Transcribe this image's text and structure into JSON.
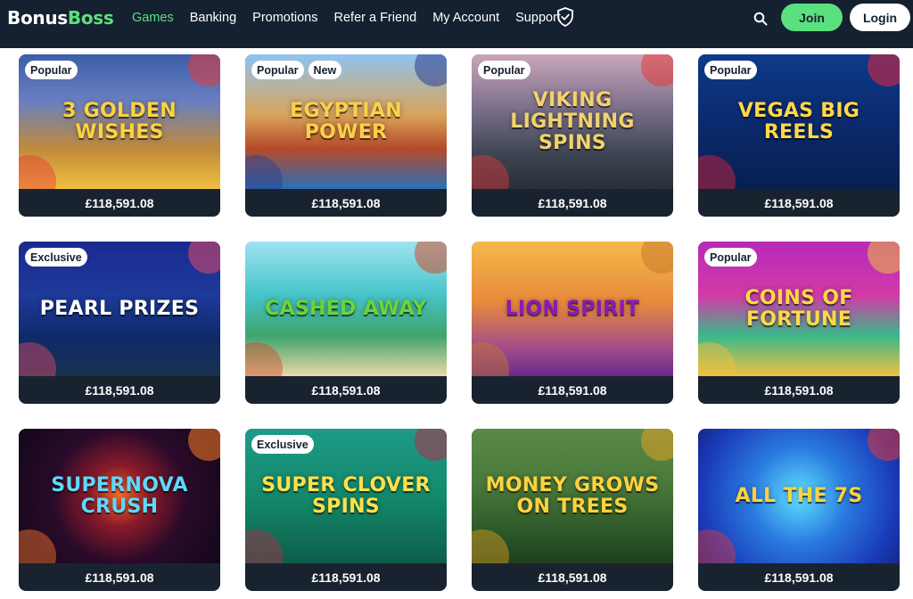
{
  "brand": {
    "part1": "Bonus",
    "part2": "Boss"
  },
  "nav": [
    {
      "label": "Games",
      "active": true
    },
    {
      "label": "Banking",
      "active": false
    },
    {
      "label": "Promotions",
      "active": false
    },
    {
      "label": "Refer a Friend",
      "active": false
    },
    {
      "label": "My Account",
      "active": false
    },
    {
      "label": "Support",
      "active": false
    }
  ],
  "header": {
    "join_label": "Join",
    "login_label": "Login",
    "search_icon": "search-icon",
    "shield_icon": "shield-check-icon"
  },
  "colors": {
    "header_bg": "#152030",
    "accent": "#5be07f",
    "card_footer": "#18232f"
  },
  "games": [
    {
      "title": "3 Golden Wishes",
      "badges": [
        "Popular"
      ],
      "jackpot": "£118,591.08",
      "bg": "linear-gradient(180deg,#3b5fa8 0%,#6a7fc0 35%,#c08a3a 70%,#f0c040 100%)",
      "titleColor": "#ffd23f",
      "deco": "#e83a3a"
    },
    {
      "title": "Egyptian Power",
      "badges": [
        "Popular",
        "New"
      ],
      "jackpot": "£118,591.08",
      "bg": "linear-gradient(180deg,#8fc3f0 0%,#d9a45a 45%,#b64a2a 70%,#2a6fb8 100%)",
      "titleColor": "#ffcf4a",
      "deco": "#2a3e8c"
    },
    {
      "title": "Viking Lightning Spins",
      "badges": [
        "Popular"
      ],
      "jackpot": "£118,591.08",
      "bg": "linear-gradient(180deg,#c9a6b8 0%,#7c6f8c 40%,#3c4452 75%,#2a2f38 100%)",
      "titleColor": "#f2d36b",
      "deco": "#e23b3b"
    },
    {
      "title": "Vegas Big Reels",
      "badges": [
        "Popular"
      ],
      "jackpot": "£118,591.08",
      "bg": "linear-gradient(180deg,#0d3a8a 0%,#0b2a6e 50%,#08204f 100%)",
      "titleColor": "#ffd84a",
      "deco": "#e5243b"
    },
    {
      "title": "Pearl Prizes",
      "badges": [
        "Exclusive"
      ],
      "jackpot": "£118,591.08",
      "bg": "linear-gradient(180deg,#1a2a8f 0%,#1e3a9a 40%,#0f2a6a 70%,#18324f 100%)",
      "titleColor": "#ffffff",
      "deco": "#e24a6a"
    },
    {
      "title": "Cashed Away",
      "badges": [],
      "jackpot": "£118,591.08",
      "bg": "linear-gradient(180deg,#9ee3f2 0%,#46c4c8 40%,#3fa36b 70%,#e9d9a8 100%)",
      "titleColor": "#6ad43a",
      "deco": "#d14a2a"
    },
    {
      "title": "Lion Spirit",
      "badges": [],
      "jackpot": "£118,591.08",
      "bg": "linear-gradient(180deg,#f5b94a 0%,#e88a3a 45%,#a04a8a 80%,#6a2a8a 100%)",
      "titleColor": "#8a1ab8",
      "deco": "#c87a2a"
    },
    {
      "title": "Coins of Fortune",
      "badges": [
        "Popular"
      ],
      "jackpot": "£118,591.08",
      "bg": "linear-gradient(180deg,#b62ab8 0%,#d43aa8 40%,#3ab88a 70%,#f0c040 100%)",
      "titleColor": "#ffd84a",
      "deco": "#f0c040"
    },
    {
      "title": "Supernova Crush",
      "badges": [],
      "jackpot": "£118,591.08",
      "bg": "radial-gradient(circle at 50% 50%,#ff6a2a 0%,#8a1a2a 25%,#2a0a2a 55%,#120818 100%)",
      "titleColor": "#5fd8ff",
      "deco": "#ff7a2a"
    },
    {
      "title": "Super Clover Spins",
      "badges": [
        "Exclusive"
      ],
      "jackpot": "£118,591.08",
      "bg": "linear-gradient(180deg,#1e9a8a 0%,#138a6a 50%,#0e5e4a 100%)",
      "titleColor": "#ffe14a",
      "deco": "#b62a4a"
    },
    {
      "title": "Money Grows On Trees",
      "badges": [],
      "jackpot": "£118,591.08",
      "bg": "linear-gradient(180deg,#5a8a4a 0%,#4a7a3a 40%,#2e5a2a 75%,#1f3e1f 100%)",
      "titleColor": "#ffd23f",
      "deco": "#e0a020"
    },
    {
      "title": "All The 7s",
      "badges": [],
      "jackpot": "£118,591.08",
      "bg": "radial-gradient(circle at 50% 50%,#5fe0ff 0%,#2a7ae0 40%,#1a3ab8 80%,#14288a 100%)",
      "titleColor": "#ffd23f",
      "deco": "#e23a3a"
    }
  ]
}
